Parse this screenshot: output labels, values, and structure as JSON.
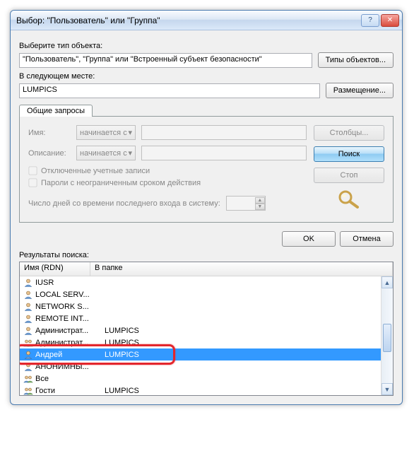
{
  "title": "Выбор: \"Пользователь\" или \"Группа\"",
  "section1": {
    "label": "Выберите тип объекта:",
    "value": "\"Пользователь\", \"Группа\" или \"Встроенный субъект безопасности\"",
    "button": "Типы объектов..."
  },
  "section2": {
    "label": "В следующем месте:",
    "value": "LUMPICS",
    "button": "Размещение..."
  },
  "tabs": {
    "common": "Общие запросы",
    "name_label": "Имя:",
    "desc_label": "Описание:",
    "begins_with": "начинается с",
    "chk_disabled": "Отключенные учетные записи",
    "chk_pw_noexp": "Пароли с неограниченным сроком действия",
    "days_label": "Число дней со времени последнего входа в систему:"
  },
  "side_buttons": {
    "columns": "Столбцы...",
    "search": "Поиск",
    "stop": "Стоп"
  },
  "bottom": {
    "ok": "OK",
    "cancel": "Отмена"
  },
  "results": {
    "label": "Результаты поиска:",
    "col_name": "Имя (RDN)",
    "col_folder": "В папке",
    "rows": [
      {
        "type": "user",
        "name": "IUSR",
        "folder": ""
      },
      {
        "type": "user",
        "name": "LOCAL SERV...",
        "folder": ""
      },
      {
        "type": "user",
        "name": "NETWORK S...",
        "folder": ""
      },
      {
        "type": "user",
        "name": "REMOTE INT...",
        "folder": ""
      },
      {
        "type": "user",
        "name": "Администрат...",
        "folder": "LUMPICS"
      },
      {
        "type": "group",
        "name": "Администрат...",
        "folder": "LUMPICS"
      },
      {
        "type": "user",
        "name": "Андрей",
        "folder": "LUMPICS",
        "selected": true
      },
      {
        "type": "user",
        "name": "АНОНИМНЫ...",
        "folder": ""
      },
      {
        "type": "group",
        "name": "Все",
        "folder": ""
      },
      {
        "type": "group",
        "name": "Гости",
        "folder": "LUMPICS"
      }
    ]
  }
}
